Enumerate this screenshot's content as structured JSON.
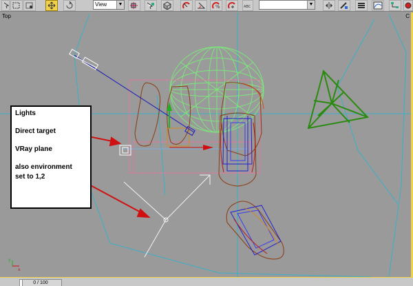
{
  "toolbar": {
    "view_dropdown": "View",
    "name_field": ""
  },
  "viewport": {
    "label": "Top",
    "corner_label": "C"
  },
  "legend": {
    "title": "Lights",
    "direct_target": "Direct target",
    "vray_plane": "VRay plane",
    "env_line1": "also environment",
    "env_line2": "set to 1,2"
  },
  "status": {
    "frame": "0 / 100"
  },
  "colors": {
    "viewport_bg": "#9a9a9a",
    "active_border": "#f2d14a",
    "grid_line": "#3ab0c8",
    "light_wire": "#7ce67c",
    "arrow_red": "#d01010"
  }
}
